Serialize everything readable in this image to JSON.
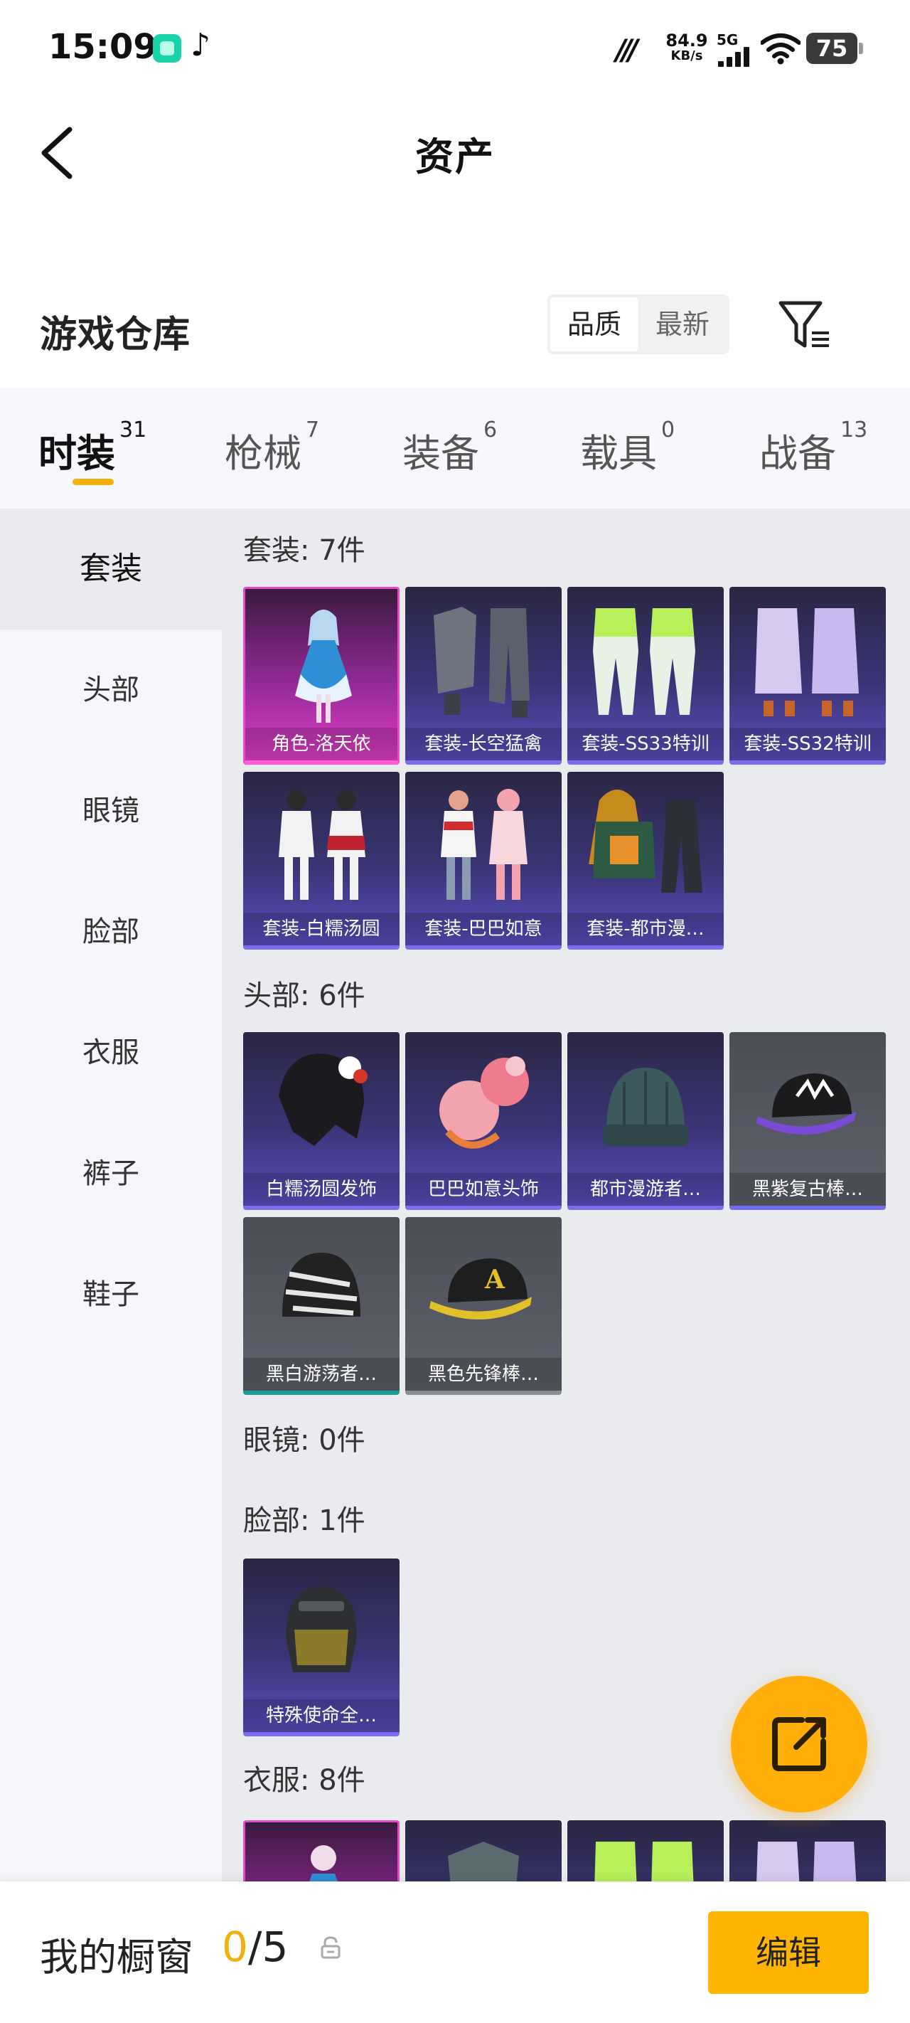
{
  "status": {
    "time": "15:09",
    "net_speed": "84.9",
    "net_unit": "KB/s",
    "network": "5G",
    "battery": "75"
  },
  "header": {
    "title": "资产"
  },
  "warehouse": {
    "title": "游戏仓库",
    "sort_options": [
      "品质",
      "最新"
    ],
    "sort_selected": "品质"
  },
  "tabs": [
    {
      "label": "时装",
      "count": "31"
    },
    {
      "label": "枪械",
      "count": "7"
    },
    {
      "label": "装备",
      "count": "6"
    },
    {
      "label": "载具",
      "count": "0"
    },
    {
      "label": "战备",
      "count": "13"
    }
  ],
  "sidebar": {
    "items": [
      "套装",
      "头部",
      "眼镜",
      "脸部",
      "衣服",
      "裤子",
      "鞋子"
    ],
    "selected": "套装"
  },
  "sections": [
    {
      "title": "套装: 7件",
      "items": [
        "角色-洛天依",
        "套装-长空猛禽",
        "套装-SS33特训",
        "套装-SS32特训",
        "套装-白糯汤圆",
        "套装-巴巴如意",
        "套装-都市漫…"
      ]
    },
    {
      "title": "头部: 6件",
      "items": [
        "白糯汤圆发饰",
        "巴巴如意头饰",
        "都市漫游者…",
        "黑紫复古棒…",
        "黑白游荡者…",
        "黑色先锋棒…"
      ]
    },
    {
      "title": "眼镜: 0件",
      "items": []
    },
    {
      "title": "脸部: 1件",
      "items": [
        "特殊使命全…"
      ]
    },
    {
      "title": "衣服: 8件",
      "items": []
    }
  ],
  "showcase": {
    "label": "我的橱窗",
    "current": "0",
    "separator": "/5",
    "edit_label": "编辑"
  },
  "colors": {
    "accent": "#f2b00a",
    "legendary": "#e24cc7",
    "epic": "#7b6cf0"
  }
}
